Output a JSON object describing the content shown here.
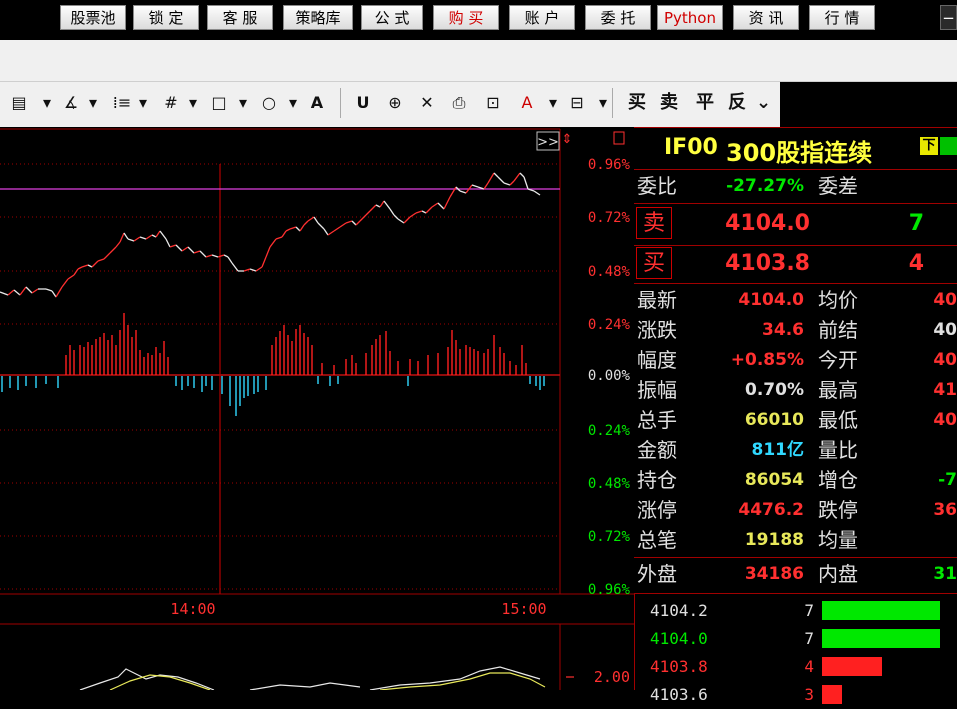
{
  "toolbar": {
    "buttons": [
      "股票池",
      "锁 定",
      "客 服",
      "策略库",
      "公 式",
      "购 买",
      "账 户",
      "委 托",
      "Python",
      "资 讯",
      "行 情"
    ],
    "more": "−"
  },
  "drawing_tools": {
    "items": [
      "▤",
      "▾",
      "∡",
      "▾",
      "⁞≡",
      "▾",
      "#",
      "▾",
      "□",
      "▾",
      "○",
      "▾",
      "A",
      "U",
      "⊕",
      "✕",
      "⎙",
      "⊡",
      "A",
      "▾",
      "⊟",
      "▾",
      "买",
      "卖",
      "平",
      "反",
      "⌄"
    ]
  },
  "chart": {
    "pct_labels_red": [
      "0.96%",
      "0.72%",
      "0.48%",
      "0.24%"
    ],
    "pct_zero": "0.00%",
    "pct_labels_green": [
      "0.24%",
      "0.48%",
      "0.72%",
      "0.96%"
    ],
    "time_labels": [
      "14:00",
      "15:00"
    ],
    "expand_label": ">>",
    "lower_axis_value": "2.00"
  },
  "quote": {
    "code": "IF00",
    "name": "300股指连续",
    "badge1": "下",
    "badge2": "",
    "weibi_label": "委比",
    "weibi_value": "-27.27%",
    "weicha_label": "委差",
    "sell_label": "卖",
    "sell_price": "4104.0",
    "sell_qty": "7",
    "buy_label": "买",
    "buy_price": "4103.8",
    "buy_qty": "4",
    "rows": [
      {
        "l": "最新",
        "v": "4104.0",
        "c": "#ff3030",
        "r": "均价",
        "rv": "40"
      },
      {
        "l": "涨跌",
        "v": "34.6",
        "c": "#ff3030",
        "r": "前结",
        "rv": "40"
      },
      {
        "l": "幅度",
        "v": "+0.85%",
        "c": "#ff3030",
        "r": "今开",
        "rv": "40"
      },
      {
        "l": "振幅",
        "v": "0.70%",
        "c": "#e0e0e0",
        "r": "最高",
        "rv": "41"
      },
      {
        "l": "总手",
        "v": "66010",
        "c": "#e8e85a",
        "r": "最低",
        "rv": "40"
      },
      {
        "l": "金额",
        "v": "811亿",
        "c": "#30d8ff",
        "r": "量比",
        "rv": ""
      },
      {
        "l": "持仓",
        "v": "86054",
        "c": "#e8e85a",
        "r": "增仓",
        "rv": "-7"
      },
      {
        "l": "涨停",
        "v": "4476.2",
        "c": "#ff3030",
        "r": "跌停",
        "rv": "36"
      },
      {
        "l": "总笔",
        "v": "19188",
        "c": "#e8e85a",
        "r": "均量",
        "rv": ""
      }
    ],
    "waipan_label": "外盘",
    "waipan_value": "34186",
    "neipan_label": "内盘",
    "neipan_value": "31",
    "ticks": [
      {
        "p": "4104.2",
        "q": "7",
        "c": "#e0e0e0",
        "bar": "#00e800",
        "w": 118
      },
      {
        "p": "4104.0",
        "q": "7",
        "c": "#00e800",
        "bar": "#00e800",
        "w": 118
      },
      {
        "p": "4103.8",
        "q": "4",
        "c": "#ff3030",
        "bar": "#ff2020",
        "w": 60
      },
      {
        "p": "4103.6",
        "q": "3",
        "c": "#e0e0e0",
        "bar": "#ff2020",
        "w": 20
      }
    ]
  },
  "colors": {
    "red": "#ff3030",
    "green": "#00e800",
    "grid": "#a00000",
    "cyan": "#30d8ff",
    "yellow": "#e8e85a"
  }
}
